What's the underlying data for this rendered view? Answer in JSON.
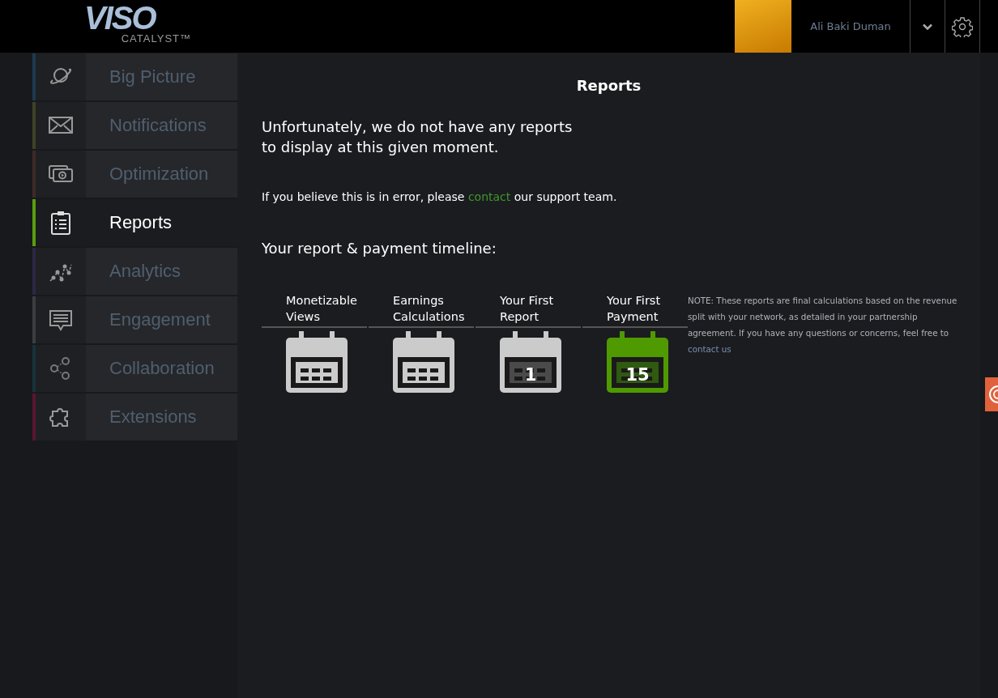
{
  "logo": {
    "wordmark": "VISO",
    "tagline": "CATALYST™"
  },
  "user": {
    "name": "Ali Baki Duman"
  },
  "sidebar": {
    "items": [
      {
        "label": "Big Picture",
        "kind": "planet",
        "color": "#1d3a4f",
        "selected": false
      },
      {
        "label": "Notifications",
        "kind": "mail",
        "color": "#3f4326",
        "selected": false
      },
      {
        "label": "Optimization",
        "kind": "video",
        "color": "#3e2a27",
        "selected": false
      },
      {
        "label": "Reports",
        "kind": "clipboard",
        "color": "#5a9c10",
        "selected": true
      },
      {
        "label": "Analytics",
        "kind": "scatter",
        "color": "#2c2744",
        "selected": false
      },
      {
        "label": "Engagement",
        "kind": "chat",
        "color": "#3c3d40",
        "selected": false
      },
      {
        "label": "Collaboration",
        "kind": "people",
        "color": "#17333a",
        "selected": false
      },
      {
        "label": "Extensions",
        "kind": "puzzle",
        "color": "#5a1530",
        "selected": false
      }
    ]
  },
  "page": {
    "title": "Reports",
    "message": "Unfortunately, we do not have any reports\nto display at this given moment.",
    "error_line": {
      "before": "If you believe this is in error, please",
      "link": "contact",
      "after": "our support team."
    },
    "timeline_heading": "Your report & payment timeline:",
    "timeline": [
      {
        "label": "Monetizable\nViews",
        "highlighted": false
      },
      {
        "label": "Earnings\nCalculations",
        "highlighted": false
      },
      {
        "label": "Your First\nReport",
        "day": "1",
        "highlighted": false
      },
      {
        "label": "Your First\nPayment",
        "day": "15",
        "highlighted": true
      }
    ],
    "note": {
      "text": "NOTE: These reports are final calculations based on the revenue split with your network, as detailed in your partnership agreement. If you have any questions or concerns, feel free to",
      "link": "contact us"
    }
  }
}
